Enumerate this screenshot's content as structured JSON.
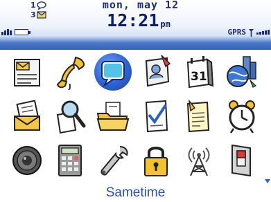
{
  "status": {
    "notifications": [
      {
        "count": "1",
        "icon": "chat-bubble-icon"
      },
      {
        "count": "3",
        "icon": "mail-envelope-icon"
      }
    ],
    "date": "mon, may 12",
    "time": "12:21",
    "ampm": "pm",
    "network": "GPRS",
    "battery_icon": "battery-icon",
    "signal_icon": "signal-strength-icon"
  },
  "apps": [
    {
      "icon": "messages-icon"
    },
    {
      "icon": "phone-icon"
    },
    {
      "icon": "sametime-icon",
      "selected": true
    },
    {
      "icon": "address-book-icon"
    },
    {
      "icon": "calendar-icon",
      "text": "31"
    },
    {
      "icon": "browser-icon"
    },
    {
      "icon": "saved-messages-icon"
    },
    {
      "icon": "search-icon"
    },
    {
      "icon": "files-folder-icon"
    },
    {
      "icon": "tasks-icon"
    },
    {
      "icon": "memopad-icon"
    },
    {
      "icon": "alarm-clock-icon"
    },
    {
      "icon": "speaker-icon"
    },
    {
      "icon": "calculator-icon"
    },
    {
      "icon": "options-wrench-icon"
    },
    {
      "icon": "lock-icon"
    },
    {
      "icon": "radio-tower-icon"
    },
    {
      "icon": "power-switch-icon"
    }
  ],
  "selected_label": "Sametime",
  "colors": {
    "accent": "#2d63d0",
    "header_text": "#1b2d7a",
    "label": "#2451b8"
  }
}
